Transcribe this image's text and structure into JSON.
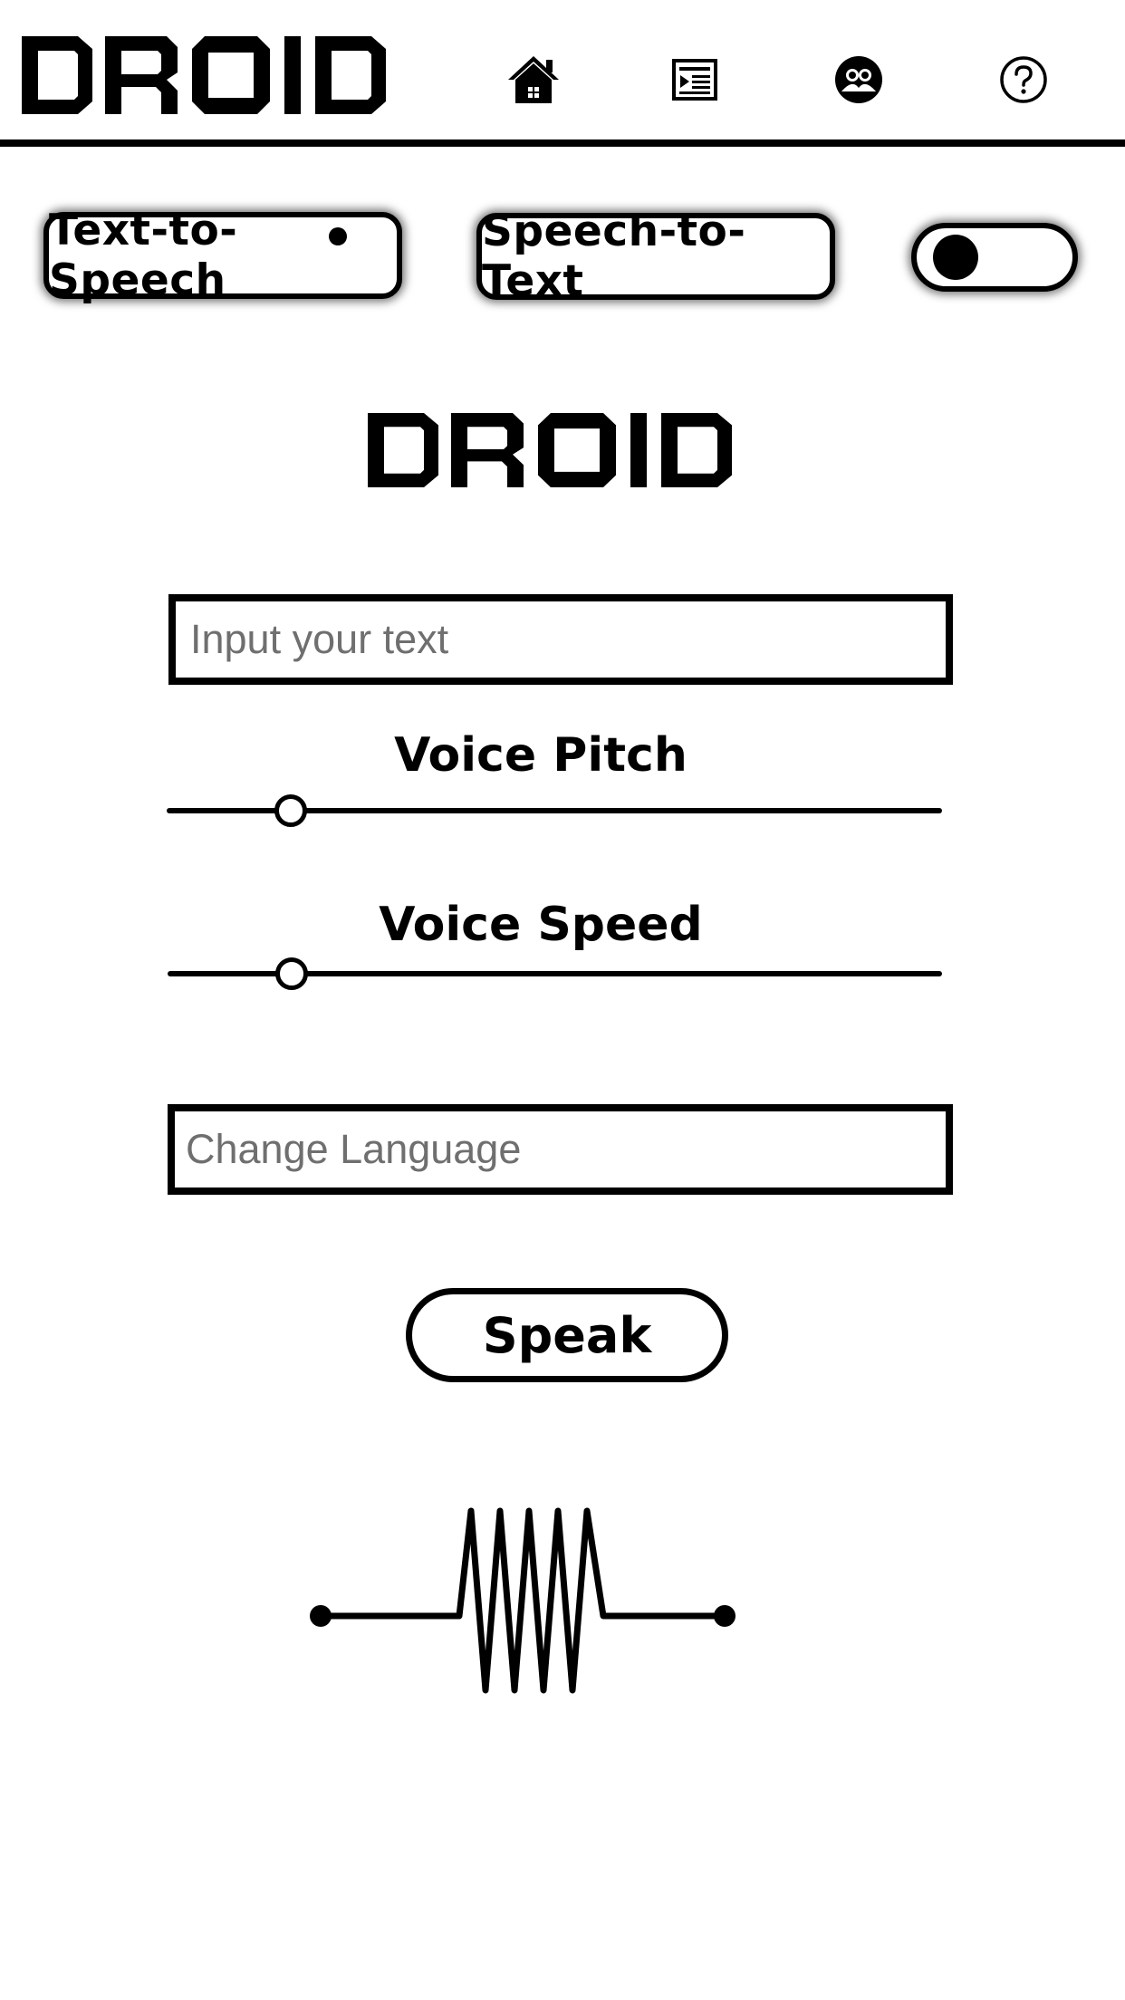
{
  "header": {
    "logo_text": "DROID",
    "nav": [
      {
        "icon": "home-icon"
      },
      {
        "icon": "article-icon"
      },
      {
        "icon": "community-icon"
      },
      {
        "icon": "help-icon"
      }
    ]
  },
  "modes": {
    "tts_label": "Text-to-Speech",
    "stt_label": "Speech-to-Text",
    "active": "Text-to-Speech",
    "toggle_on": false
  },
  "main": {
    "logo_text": "DROID",
    "text_input": {
      "placeholder": "Input your text",
      "value": ""
    },
    "pitch": {
      "label": "Voice Pitch",
      "value_fraction": 0.16
    },
    "speed": {
      "label": "Voice Speed",
      "value_fraction": 0.16
    },
    "language_input": {
      "placeholder": "Change Language",
      "value": ""
    },
    "speak_label": "Speak",
    "waveform_icon": "resistor-waveform-icon"
  },
  "colors": {
    "foreground": "#000000",
    "background": "#ffffff",
    "placeholder": "#6f6f6f"
  }
}
